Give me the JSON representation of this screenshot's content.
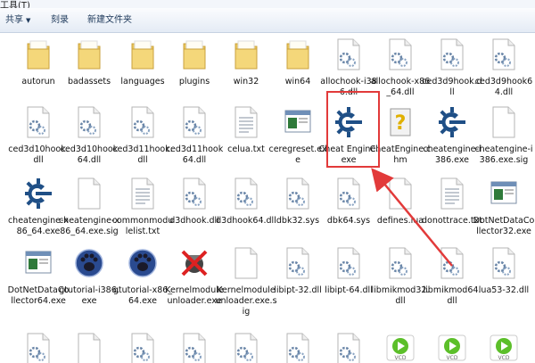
{
  "menubar": {
    "partial_label": "工具(T)"
  },
  "toolbar": {
    "share_label": "共享",
    "burn_label": "刻录",
    "new_folder_label": "新建文件夹"
  },
  "files": [
    {
      "label": "autorun",
      "icon": "folder-icon"
    },
    {
      "label": "badassets",
      "icon": "folder-icon"
    },
    {
      "label": "languages",
      "icon": "folder-icon"
    },
    {
      "label": "plugins",
      "icon": "folder-icon"
    },
    {
      "label": "win32",
      "icon": "folder-icon"
    },
    {
      "label": "win64",
      "icon": "folder-icon"
    },
    {
      "label": "allochook-i386.dll",
      "icon": "dll-icon"
    },
    {
      "label": "allochook-x86_64.dll",
      "icon": "dll-icon"
    },
    {
      "label": "ced3d9hook.dll",
      "icon": "dll-icon"
    },
    {
      "label": "ced3d9hook64.dll",
      "icon": "dll-icon"
    },
    {
      "label": "ced3d10hook.dll",
      "icon": "dll-icon"
    },
    {
      "label": "ced3d10hook64.dll",
      "icon": "dll-icon"
    },
    {
      "label": "ced3d11hook.dll",
      "icon": "dll-icon"
    },
    {
      "label": "ced3d11hook64.dll",
      "icon": "dll-icon"
    },
    {
      "label": "celua.txt",
      "icon": "text-file-icon"
    },
    {
      "label": "ceregreset.exe",
      "icon": "window-exe-icon"
    },
    {
      "label": "Cheat Engine.exe",
      "icon": "cheat-engine-icon"
    },
    {
      "label": "CheatEngine.chm",
      "icon": "help-file-icon"
    },
    {
      "label": "cheatengine-i386.exe",
      "icon": "cheat-engine-icon"
    },
    {
      "label": "cheatengine-i386.exe.sig",
      "icon": "blank-file-icon"
    },
    {
      "label": "cheatengine-x86_64.exe",
      "icon": "cheat-engine-icon"
    },
    {
      "label": "cheatengine-x86_64.exe.sig",
      "icon": "blank-file-icon"
    },
    {
      "label": "commonmodulelist.txt",
      "icon": "text-file-icon"
    },
    {
      "label": "d3dhook.dll",
      "icon": "dll-icon"
    },
    {
      "label": "d3dhook64.dll",
      "icon": "dll-icon"
    },
    {
      "label": "dbk32.sys",
      "icon": "dll-icon"
    },
    {
      "label": "dbk64.sys",
      "icon": "dll-icon"
    },
    {
      "label": "defines.lua",
      "icon": "blank-file-icon"
    },
    {
      "label": "donottrace.txt",
      "icon": "text-file-icon"
    },
    {
      "label": "DotNetDataCollector32.exe",
      "icon": "window-exe-icon"
    },
    {
      "label": "DotNetDataCollector64.exe",
      "icon": "window-exe-icon"
    },
    {
      "label": "gtutorial-i386.exe",
      "icon": "paw-icon"
    },
    {
      "label": "gtutorial-x86_64.exe",
      "icon": "paw-icon"
    },
    {
      "label": "Kernelmoduleunloader.exe",
      "icon": "crossed-icon"
    },
    {
      "label": "Kernelmoduleunloader.exe.sig",
      "icon": "blank-file-icon"
    },
    {
      "label": "libipt-32.dll",
      "icon": "dll-icon"
    },
    {
      "label": "libipt-64.dll",
      "icon": "dll-icon"
    },
    {
      "label": "libmikmod32.dll",
      "icon": "dll-icon"
    },
    {
      "label": "libmikmod64.dll",
      "icon": "dll-icon"
    },
    {
      "label": "lua53-32.dll",
      "icon": "dll-icon"
    },
    {
      "label": "",
      "icon": "dll-icon"
    },
    {
      "label": "",
      "icon": "blank-file-icon"
    },
    {
      "label": "",
      "icon": "dll-icon"
    },
    {
      "label": "",
      "icon": "dll-icon"
    },
    {
      "label": "",
      "icon": "dll-icon"
    },
    {
      "label": "",
      "icon": "dll-icon"
    },
    {
      "label": "",
      "icon": "dll-icon"
    },
    {
      "label": "",
      "icon": "vcd-icon",
      "badge": "VCD"
    },
    {
      "label": "",
      "icon": "vcd-icon",
      "badge": "VCD"
    },
    {
      "label": "",
      "icon": "vcd-icon",
      "badge": "VCD"
    }
  ],
  "colors": {
    "highlight": "#e23a3a",
    "folder": "#f0cf6a",
    "cheat_engine": "#1f4f86"
  }
}
